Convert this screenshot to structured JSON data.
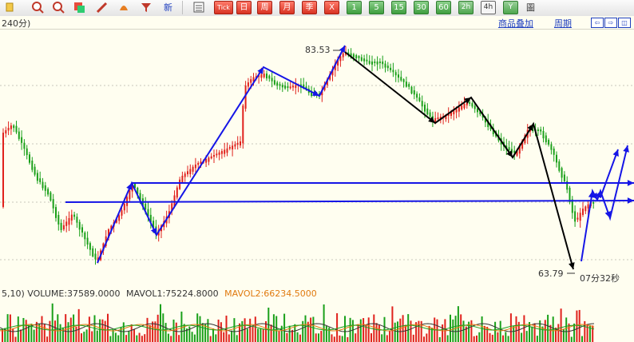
{
  "toolbar": {
    "icons": [
      "zoom-in-icon",
      "zoom-in-icon",
      "zoom-out-icon",
      "layout-icon",
      "pencil-icon",
      "bell-icon",
      "filter-icon",
      "new-icon",
      "list-icon",
      "tick-icon",
      "day-icon",
      "week-icon",
      "month-icon",
      "season-icon",
      "year-icon",
      "min1-icon",
      "min5-icon",
      "min15-icon",
      "min30-icon",
      "min60-icon",
      "min120-icon",
      "min240-icon",
      "y-icon",
      "window-icon"
    ],
    "new_label": "新",
    "tick_label": "Tick",
    "day_label": "日",
    "week_label": "周",
    "month_label": "月",
    "season_label": "季",
    "year_label": "X",
    "p1": "1",
    "p5": "5",
    "p15": "15",
    "p30": "30",
    "p60": "60",
    "p120": "2h",
    "p240": "4h",
    "py": "Y",
    "win": "圖"
  },
  "subbar": {
    "period": "240分)",
    "overlay": "商品叠加",
    "cycle": "周期"
  },
  "chart": {
    "high_label": "83.53",
    "low_label": "63.79",
    "countdown": "07分32秒",
    "colors": {
      "up": "#e0211c",
      "down": "#1aa01a",
      "blue_line": "#1515e6",
      "black_line": "#000000",
      "grid": "#c8c8bd"
    }
  },
  "chart_data": {
    "type": "candlestick",
    "high": 83.53,
    "low": 63.79
  },
  "volume": {
    "label": "5,10) VOLUME:37589.0000",
    "mavol1": "MAVOL1:75224.8000",
    "mavol2": "MAVOL2:66234.5000"
  }
}
